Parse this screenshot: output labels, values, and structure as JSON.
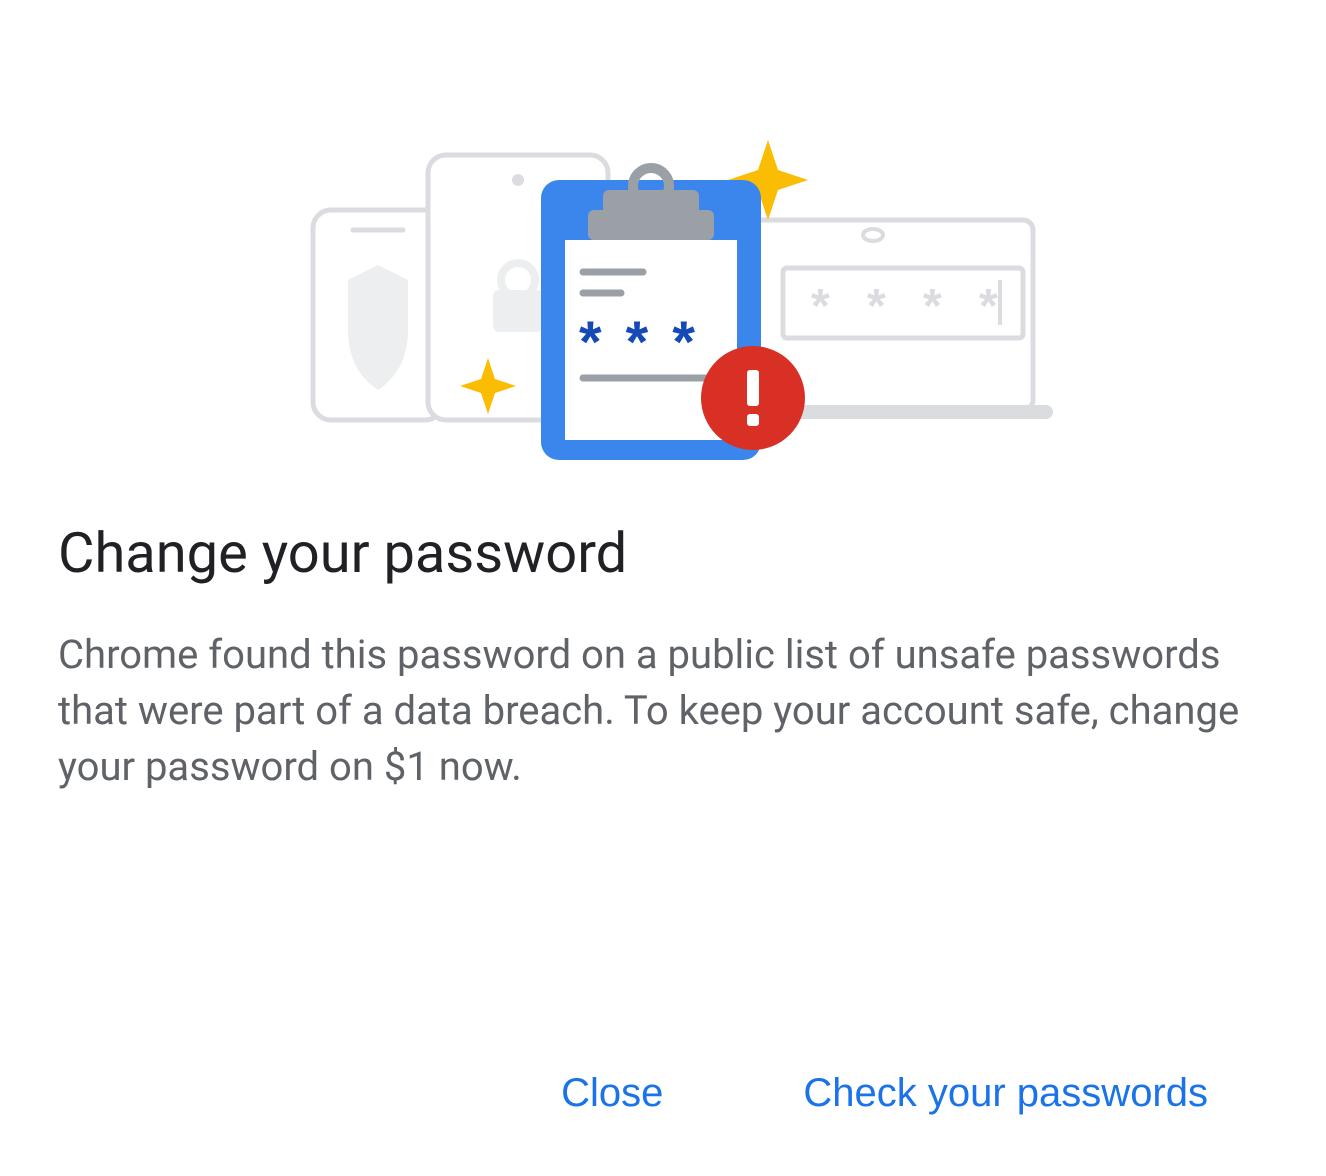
{
  "dialog": {
    "title": "Change your password",
    "body": "Chrome found this password on a public list of unsafe passwords that were part of a data breach. To keep your account safe, change your password on $1 now.",
    "buttons": {
      "close": "Close",
      "check": "Check your passwords"
    }
  }
}
